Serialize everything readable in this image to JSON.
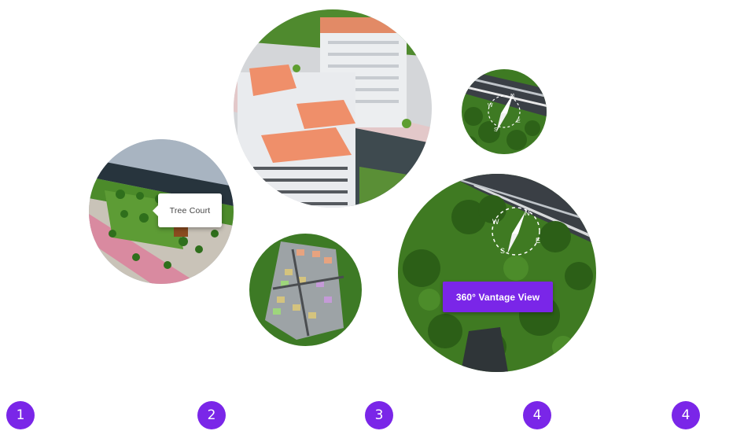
{
  "tooltip": {
    "label": "Tree Court"
  },
  "vantage": {
    "button_label": "360° Vantage View"
  },
  "compass": {
    "n": "N",
    "e": "E",
    "s": "S",
    "w": "W"
  },
  "steps": [
    "1",
    "2",
    "3",
    "4",
    "4"
  ],
  "colors": {
    "accent": "#7a26e8",
    "grass": "#3f7a22",
    "roof": "#ef8f6a"
  }
}
